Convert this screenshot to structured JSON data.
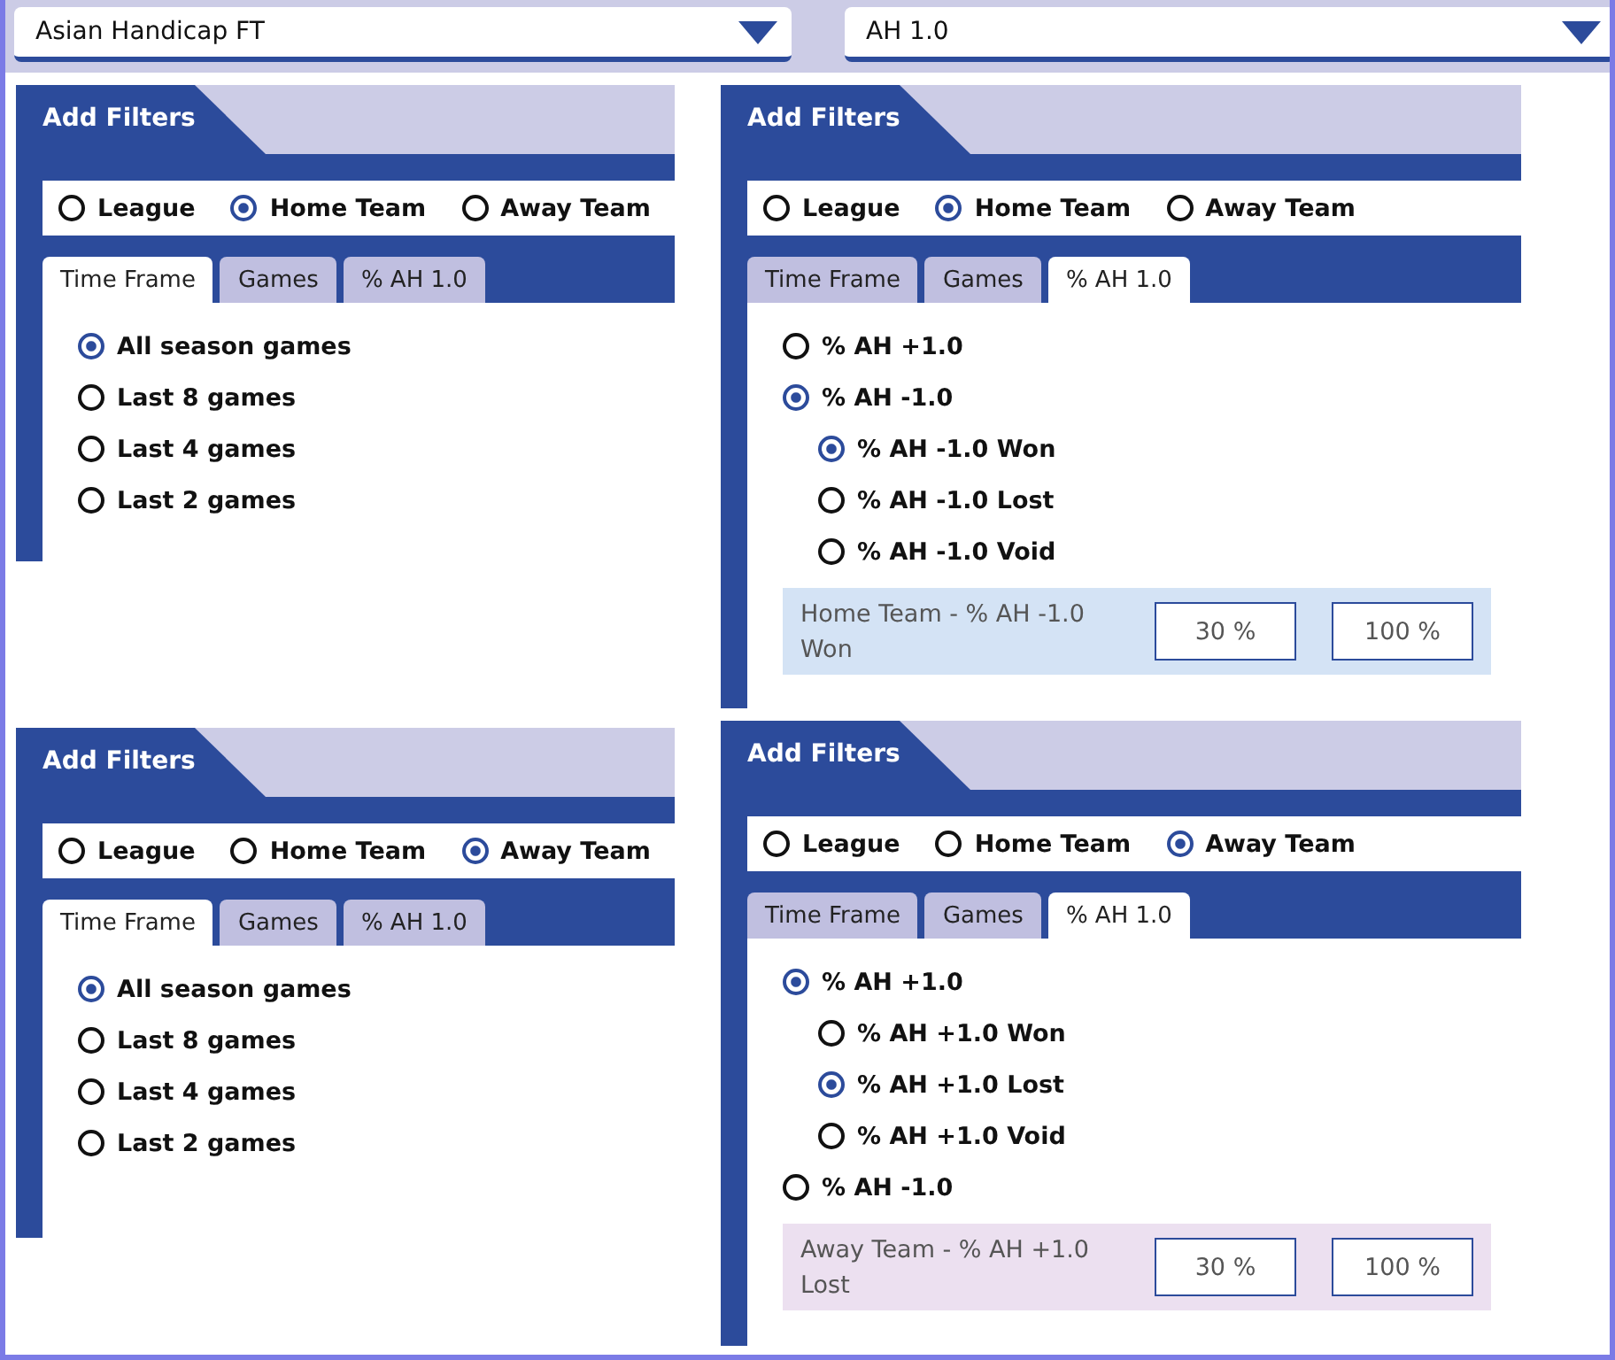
{
  "selectors": [
    {
      "value": "Asian Handicap FT"
    },
    {
      "value": "AH 1.0"
    }
  ],
  "panels": [
    {
      "title": "Add Filters",
      "scope": [
        {
          "label": "League",
          "selected": false
        },
        {
          "label": "Home Team",
          "selected": true
        },
        {
          "label": "Away Team",
          "selected": false
        }
      ],
      "tabs": [
        {
          "label": "Time Frame",
          "selected": true
        },
        {
          "label": "Games",
          "selected": false
        },
        {
          "label": "% AH 1.0",
          "selected": false
        }
      ],
      "options": [
        {
          "label": "All season games",
          "selected": true
        },
        {
          "label": "Last 8 games",
          "selected": false
        },
        {
          "label": "Last 4 games",
          "selected": false
        },
        {
          "label": "Last 2 games",
          "selected": false
        }
      ]
    },
    {
      "title": "Add Filters",
      "scope": [
        {
          "label": "League",
          "selected": false
        },
        {
          "label": "Home Team",
          "selected": true
        },
        {
          "label": "Away Team",
          "selected": false
        }
      ],
      "tabs": [
        {
          "label": "Time Frame",
          "selected": false
        },
        {
          "label": "Games",
          "selected": false
        },
        {
          "label": "% AH 1.0",
          "selected": true
        }
      ],
      "options": [
        {
          "label": "% AH +1.0",
          "selected": false
        },
        {
          "label": "% AH -1.0",
          "selected": true,
          "children": [
            {
              "label": "% AH -1.0 Won",
              "selected": true
            },
            {
              "label": "% AH -1.0 Lost",
              "selected": false
            },
            {
              "label": "% AH -1.0 Void",
              "selected": false
            }
          ]
        }
      ],
      "summary": {
        "label": "Home Team - % AH -1.0 Won",
        "min": "30 %",
        "max": "100 %",
        "color": "#d4e3f5"
      }
    },
    {
      "title": "Add Filters",
      "scope": [
        {
          "label": "League",
          "selected": false
        },
        {
          "label": "Home Team",
          "selected": false
        },
        {
          "label": "Away Team",
          "selected": true
        }
      ],
      "tabs": [
        {
          "label": "Time Frame",
          "selected": true
        },
        {
          "label": "Games",
          "selected": false
        },
        {
          "label": "% AH 1.0",
          "selected": false
        }
      ],
      "options": [
        {
          "label": "All season games",
          "selected": true
        },
        {
          "label": "Last 8 games",
          "selected": false
        },
        {
          "label": "Last 4 games",
          "selected": false
        },
        {
          "label": "Last 2 games",
          "selected": false
        }
      ]
    },
    {
      "title": "Add Filters",
      "scope": [
        {
          "label": "League",
          "selected": false
        },
        {
          "label": "Home Team",
          "selected": false
        },
        {
          "label": "Away Team",
          "selected": true
        }
      ],
      "tabs": [
        {
          "label": "Time Frame",
          "selected": false
        },
        {
          "label": "Games",
          "selected": false
        },
        {
          "label": "% AH 1.0",
          "selected": true
        }
      ],
      "options": [
        {
          "label": "% AH +1.0",
          "selected": true,
          "children": [
            {
              "label": "% AH +1.0 Won",
              "selected": false
            },
            {
              "label": "% AH +1.0 Lost",
              "selected": true
            },
            {
              "label": "% AH +1.0 Void",
              "selected": false
            }
          ]
        },
        {
          "label": "% AH -1.0",
          "selected": false
        }
      ],
      "summary": {
        "label": "Away Team - % AH +1.0 Lost",
        "min": "30 %",
        "max": "100 %",
        "color": "#ece0f0"
      }
    }
  ]
}
